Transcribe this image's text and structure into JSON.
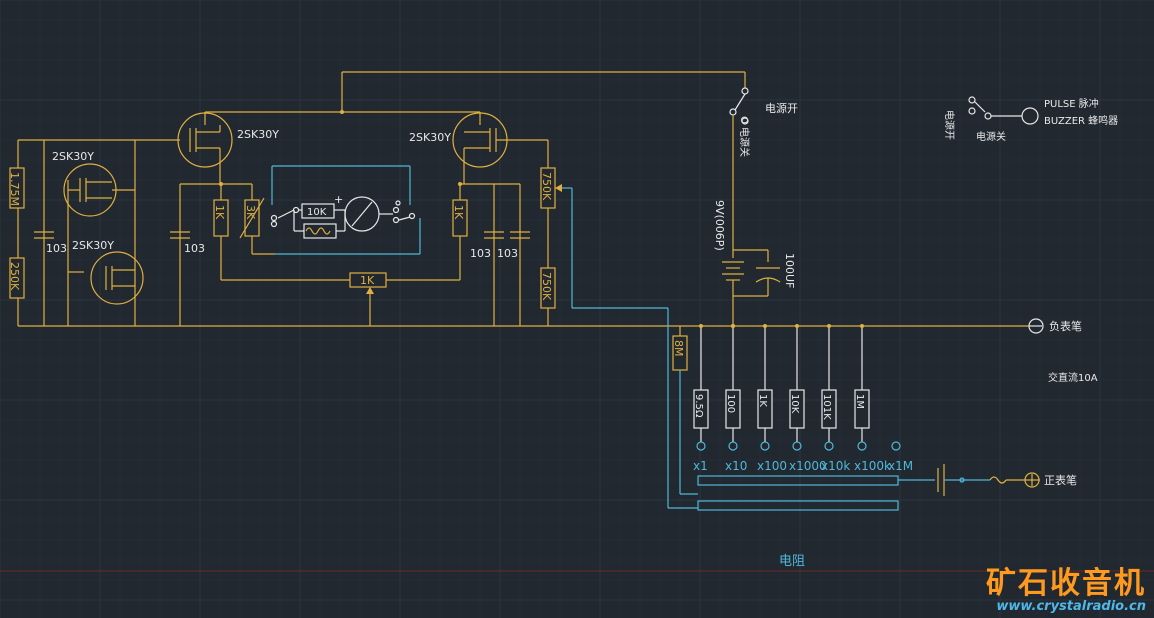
{
  "colors": {
    "background": "#212830",
    "wire": "#e0b040",
    "signal": "#4fb8d8",
    "text": "#e8e8e8",
    "watermark": "#ff9a1e",
    "url": "#4fb8e8"
  },
  "transistors": {
    "q_left_top": "2SK30Y",
    "q_left_bottom": "2SK30Y",
    "q_top_left": "2SK30Y",
    "q_top_right": "2SK30Y"
  },
  "resistors": {
    "r_1_75m": "1.75M",
    "r_250k_left": "250K",
    "r_1k_left": "1K",
    "r_3k": "3K",
    "r_10k": "10K",
    "r_1k_right": "1K",
    "r_1k_bottom": "1K",
    "r_750k_top": "750K",
    "r_750k_bottom": "750K",
    "r_8m": "8M",
    "r_9_5": "9.5Ω",
    "r_100": "100",
    "r_1k": "1K",
    "r_10k_range": "10K",
    "r_101k": "101K",
    "r_1m": "1M"
  },
  "capacitors": {
    "c1": "103",
    "c2": "103",
    "c3": "103",
    "c4": "103",
    "c_big": "100UF"
  },
  "battery": "9V(006P)",
  "labels": {
    "power_on": "电源开",
    "power_off_vertical": "O 电源关",
    "pulse": "PULSE 脉冲",
    "buzzer": "BUZZER 蜂鸣器",
    "power_on_right": "电源开",
    "power_off_right": "电源关",
    "neg_probe": "负表笔",
    "pos_probe": "正表笔",
    "ac_dc": "交直流10A",
    "resistance": "电阻"
  },
  "ranges": [
    "x1",
    "x10",
    "x100",
    "x1000",
    "x10k",
    "x100k",
    "x1M"
  ],
  "watermark": {
    "title": "矿石收音机",
    "url": "www.crystalradio.cn"
  }
}
